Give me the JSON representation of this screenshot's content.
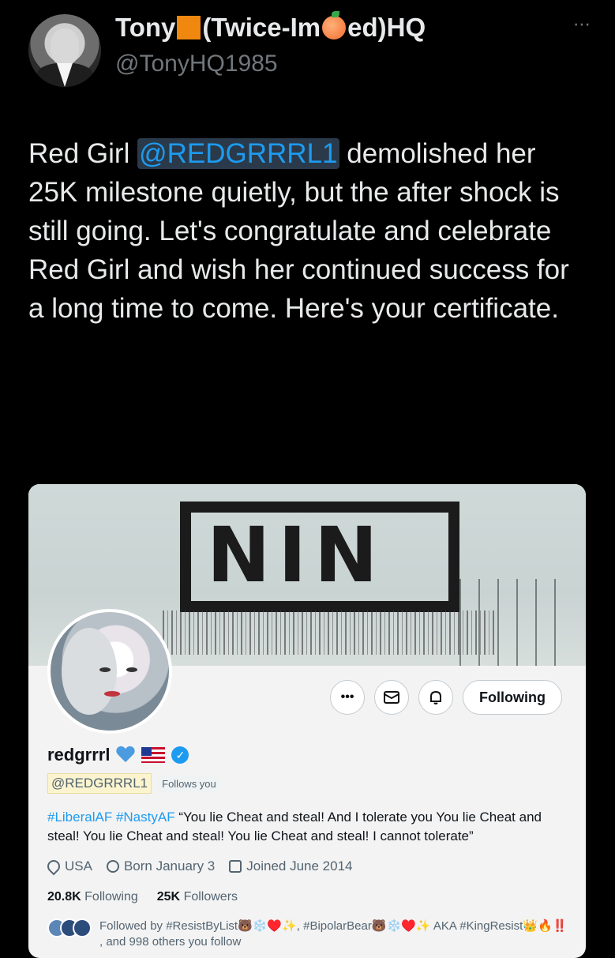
{
  "tweet": {
    "display_name_parts": [
      "Tony",
      "(Twice-Im",
      "ed)HQ"
    ],
    "handle": "@TonyHQ1985",
    "more_icon": "⋯",
    "text_before": "Red Girl ",
    "mention": "@REDGRRRL1",
    "text_after": " demolished her 25K milestone quietly, but the after shock is still going. Let's congratulate and celebrate Red Girl and wish her continued success for a long time to come. Here's your certificate."
  },
  "profile_card": {
    "banner_text": "NIN",
    "actions": {
      "more": "•••",
      "message_icon": "envelope-icon",
      "notify_icon": "bell-plus-icon",
      "following_label": "Following"
    },
    "name": "redgrrrl",
    "handle": "@REDGRRRL1",
    "follows_you": "Follows you",
    "bio_hashtag1": "#LiberalAF",
    "bio_hashtag2": "#NastyAF",
    "bio_text": " “You lie Cheat and steal! And I tolerate you You lie Cheat and steal! You lie Cheat and steal! You lie Cheat and steal! I cannot tolerate”",
    "location": "USA",
    "birthday": "Born January 3",
    "joined": "Joined June 2014",
    "following_count": "20.8K",
    "following_label": "Following",
    "followers_count": "25K",
    "followers_label": "Followers",
    "followed_by_line1": "Followed by #ResistByList🐻❄️♥️✨, #BipolarBear🐻❄️♥️✨ AKA #KingResist👑🔥‼️",
    "followed_by_line2": ", and 998 others you follow"
  }
}
